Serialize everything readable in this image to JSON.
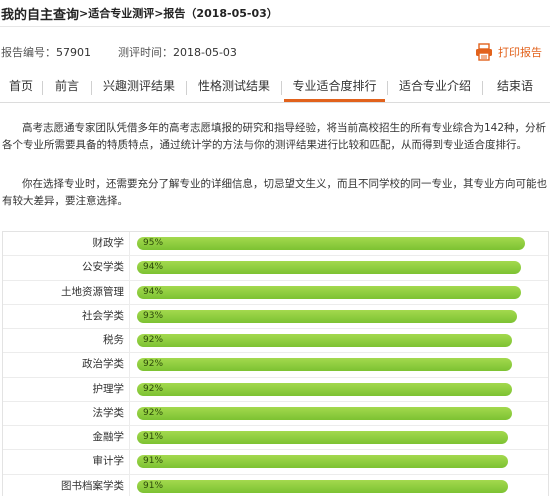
{
  "breadcrumb": {
    "title": "我的自主查询",
    "path": ">适合专业测评>报告（2018-05-03）"
  },
  "meta": {
    "report_no_label": "报告编号：",
    "report_no": "57901",
    "test_time_label": "测评时间：",
    "test_time": "2018-05-03",
    "print_label": "打印报告",
    "print_icon": "printer-icon"
  },
  "tabs": [
    {
      "label": "首页",
      "active": false
    },
    {
      "label": "前言",
      "active": false
    },
    {
      "label": "兴趣测评结果",
      "active": false
    },
    {
      "label": "性格测试结果",
      "active": false
    },
    {
      "label": "专业适合度排行",
      "active": true
    },
    {
      "label": "适合专业介绍",
      "active": false
    },
    {
      "label": "结束语",
      "active": false
    }
  ],
  "intro": {
    "p1": "高考志愿通专家团队凭借多年的高考志愿填报的研究和指导经验，将当前高校招生的所有专业综合为142种，分析各个专业所需要具备的特质特点，通过统计学的方法与你的测评结果进行比较和匹配，从而得到专业适合度排行。",
    "p2": "你在选择专业时，还需要充分了解专业的详细信息，切忌望文生义，而且不同学校的同一专业，其专业方向可能也有较大差异，要注意选择。"
  },
  "ranking": [
    {
      "name": "财政学",
      "percent": 95,
      "label": "95%"
    },
    {
      "name": "公安学类",
      "percent": 94,
      "label": "94%"
    },
    {
      "name": "土地资源管理",
      "percent": 94,
      "label": "94%"
    },
    {
      "name": "社会学类",
      "percent": 93,
      "label": "93%"
    },
    {
      "name": "税务",
      "percent": 92,
      "label": "92%"
    },
    {
      "name": "政治学类",
      "percent": 92,
      "label": "92%"
    },
    {
      "name": "护理学",
      "percent": 92,
      "label": "92%"
    },
    {
      "name": "法学类",
      "percent": 92,
      "label": "92%"
    },
    {
      "name": "金融学",
      "percent": 91,
      "label": "91%"
    },
    {
      "name": "审计学",
      "percent": 91,
      "label": "91%"
    },
    {
      "name": "图书档案学类",
      "percent": 91,
      "label": "91%"
    }
  ],
  "colors": {
    "accent": "#e2621c",
    "bar": "#8ccb3c"
  }
}
